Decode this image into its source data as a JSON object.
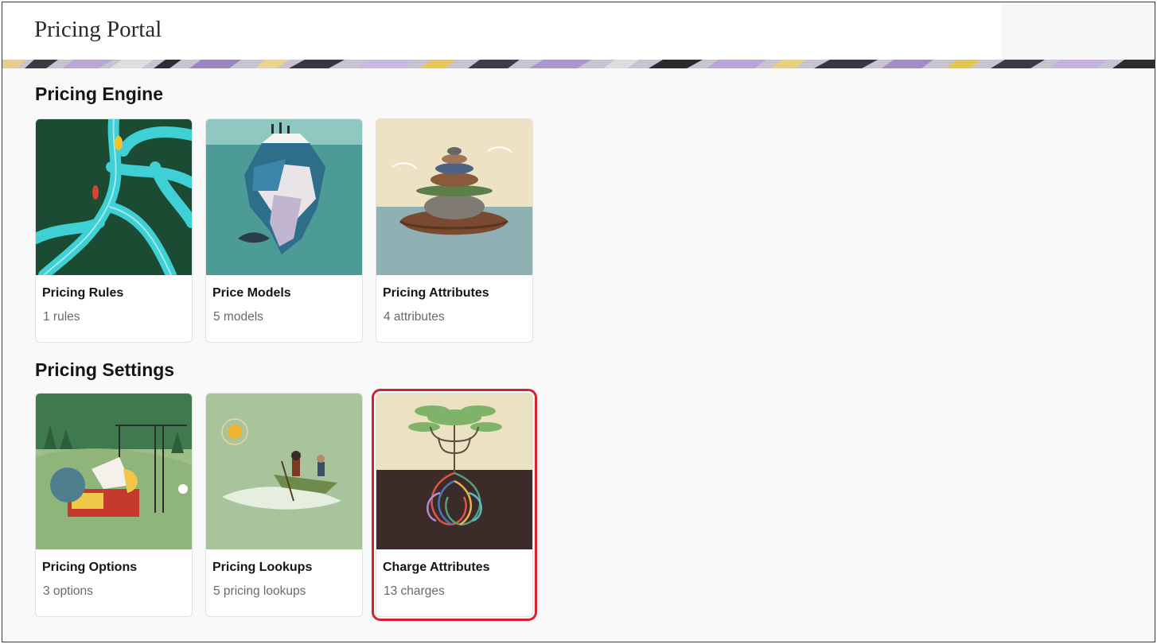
{
  "header": {
    "title": "Pricing Portal"
  },
  "sections": [
    {
      "title": "Pricing Engine",
      "cards": [
        {
          "title": "Pricing Rules",
          "subtitle": "1 rules",
          "image": "river-branches-illustration"
        },
        {
          "title": "Price Models",
          "subtitle": "5 models",
          "image": "iceberg-illustration"
        },
        {
          "title": "Pricing Attributes",
          "subtitle": "4 attributes",
          "image": "stacked-stones-illustration"
        }
      ]
    },
    {
      "title": "Pricing Settings",
      "cards": [
        {
          "title": "Pricing Options",
          "subtitle": "3 options",
          "image": "crane-blocks-illustration"
        },
        {
          "title": "Pricing Lookups",
          "subtitle": "5 pricing lookups",
          "image": "canoe-illustration"
        },
        {
          "title": "Charge Attributes",
          "subtitle": "13 charges",
          "image": "tree-roots-illustration",
          "selected": true
        }
      ]
    }
  ],
  "colors": {
    "selected_outline": "#d2232f",
    "page_background": "#f9f9f9",
    "subtitle_text": "#6b6964"
  }
}
